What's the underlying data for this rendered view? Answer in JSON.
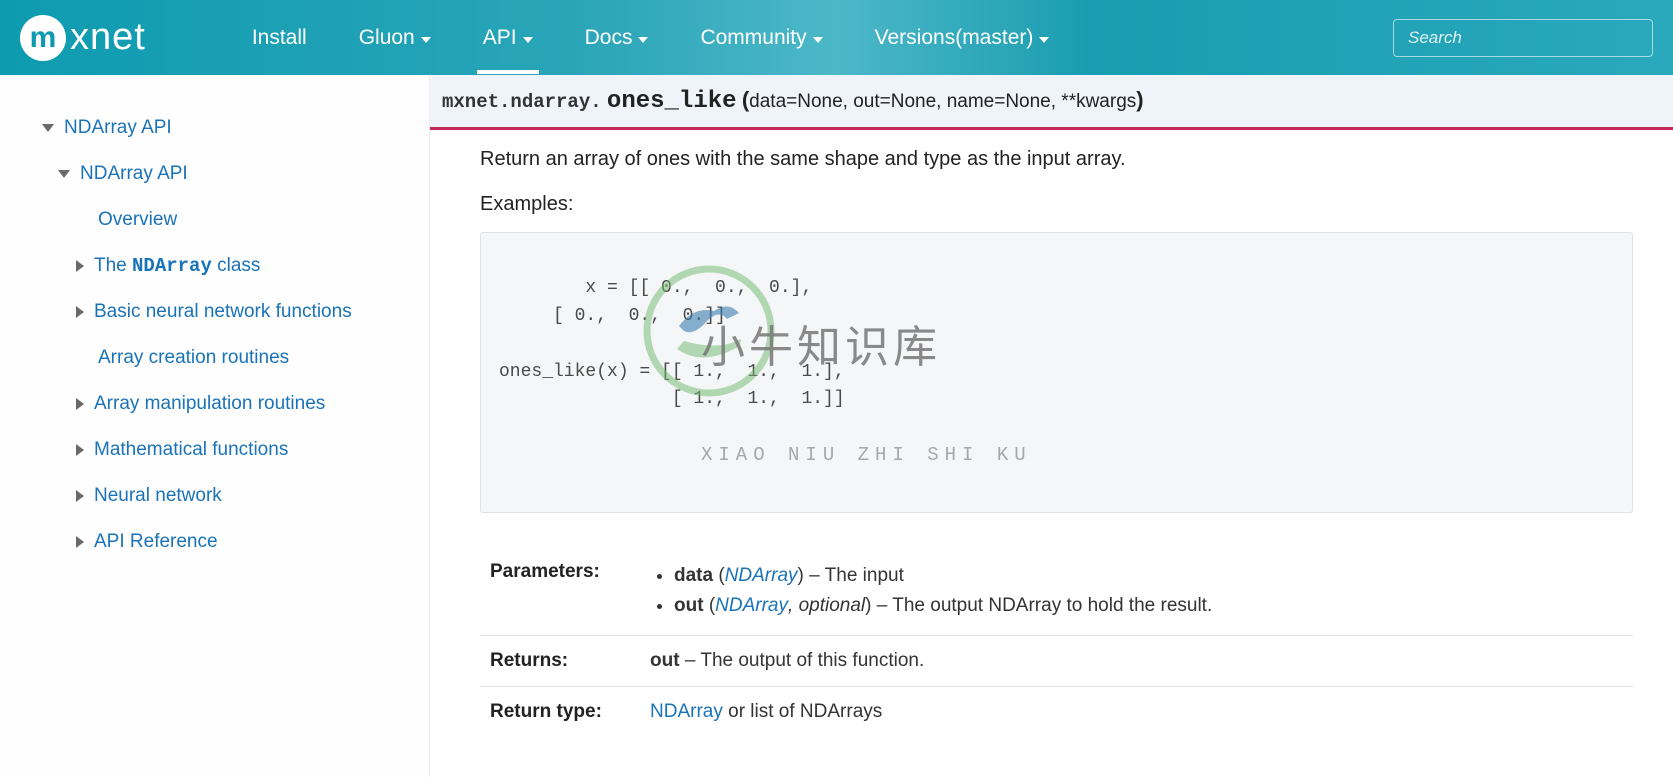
{
  "header": {
    "logo_badge": "m",
    "logo_text": "xnet",
    "nav": [
      {
        "label": "Install",
        "dropdown": false,
        "active": false
      },
      {
        "label": "Gluon",
        "dropdown": true,
        "active": false
      },
      {
        "label": "API",
        "dropdown": true,
        "active": true
      },
      {
        "label": "Docs",
        "dropdown": true,
        "active": false
      },
      {
        "label": "Community",
        "dropdown": true,
        "active": false
      },
      {
        "label": "Versions(master)",
        "dropdown": true,
        "active": false
      }
    ],
    "search_placeholder": "Search"
  },
  "sidebar": {
    "items": [
      {
        "label": "NDArray API",
        "level": 1,
        "caret": "open"
      },
      {
        "label": "NDArray API",
        "level": 2,
        "caret": "open"
      },
      {
        "label": "Overview",
        "level": 3,
        "caret": "none"
      },
      {
        "label_pre": "The ",
        "label_code": "NDArray",
        "label_post": " class",
        "level": 3,
        "caret": "closed"
      },
      {
        "label": "Basic neural network functions",
        "level": 3,
        "caret": "closed"
      },
      {
        "label": "Array creation routines",
        "level": 3,
        "caret": "none"
      },
      {
        "label": "Array manipulation routines",
        "level": 3,
        "caret": "closed"
      },
      {
        "label": "Mathematical functions",
        "level": 3,
        "caret": "closed"
      },
      {
        "label": "Neural network",
        "level": 3,
        "caret": "closed"
      },
      {
        "label": "API Reference",
        "level": 3,
        "caret": "closed"
      }
    ]
  },
  "signature": {
    "prefix": "mxnet.ndarray.",
    "name": "ones_like",
    "params": "data=None, out=None, name=None, **kwargs"
  },
  "content": {
    "description": "Return an array of ones with the same shape and type as the input array.",
    "examples_label": "Examples:",
    "code": "x = [[ 0.,  0.,  0.],\n     [ 0.,  0.,  0.]]\n\nones_like(x) = [[ 1.,  1.,  1.],\n                [ 1.,  1.,  1.]]"
  },
  "watermark": {
    "cn": "小牛知识库",
    "en": "XIAO NIU ZHI SHI KU"
  },
  "params_table": {
    "parameters_label": "Parameters:",
    "param_data_name": "data",
    "param_data_type": "NDArray",
    "param_data_desc": "The input",
    "param_out_name": "out",
    "param_out_type": "NDArray",
    "param_out_opt": "optional",
    "param_out_desc": "The output NDArray to hold the result.",
    "returns_label": "Returns:",
    "returns_name": "out",
    "returns_desc": "The output of this function.",
    "return_type_label": "Return type:",
    "return_type_link": "NDArray",
    "return_type_rest": "or list of NDArrays"
  }
}
